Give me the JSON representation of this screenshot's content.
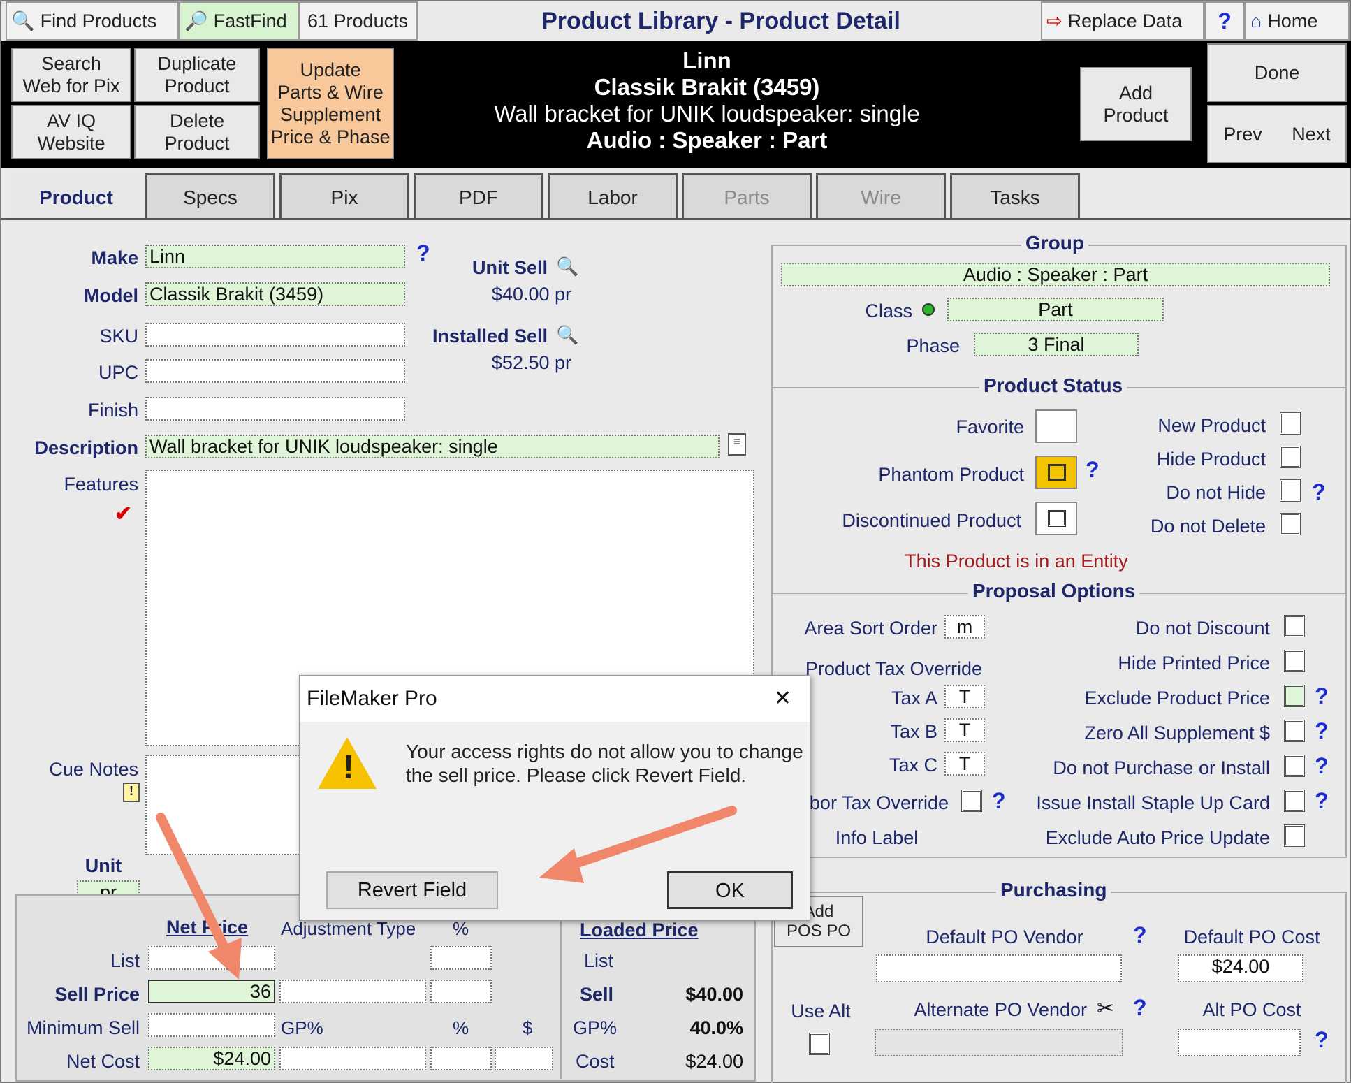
{
  "toolbar": {
    "find": "Find Products",
    "fastfind": "FastFind",
    "count": "61 Products",
    "title": "Product Library - Product Detail",
    "replace": "Replace Data",
    "help": "?",
    "home": "Home"
  },
  "nav": {
    "search1": "Search",
    "search2": "Web for Pix",
    "dup1": "Duplicate",
    "dup2": "Product",
    "av1": "AV IQ",
    "av2": "Website",
    "del1": "Delete",
    "del2": "Product",
    "upd1": "Update",
    "upd2": "Parts & Wire",
    "upd3": "Supplement",
    "upd4": "Price & Phase",
    "add1": "Add",
    "add2": "Product",
    "done": "Done",
    "prev": "Prev",
    "next": "Next"
  },
  "header": {
    "make": "Linn",
    "model": "Classik Brakit (3459)",
    "desc": "Wall bracket for UNIK loudspeaker: single",
    "group": "Audio : Speaker : Part"
  },
  "tabs": [
    "Product",
    "Specs",
    "Pix",
    "PDF",
    "Labor",
    "Parts",
    "Wire",
    "Tasks"
  ],
  "product": {
    "make_label": "Make",
    "make": "Linn",
    "model_label": "Model",
    "model": "Classik Brakit (3459)",
    "sku_label": "SKU",
    "upc_label": "UPC",
    "finish_label": "Finish",
    "desc_label": "Description",
    "desc": "Wall bracket for UNIK loudspeaker: single",
    "features_label": "Features",
    "cue_label": "Cue Notes",
    "unit_label": "Unit",
    "unit": "pr",
    "unit_sell_label": "Unit Sell",
    "unit_sell": "$40.00 pr",
    "inst_sell_label": "Installed Sell",
    "inst_sell": "$52.50 pr",
    "q": "?"
  },
  "group": {
    "title": "Group",
    "value": "Audio : Speaker : Part",
    "class_label": "Class",
    "class": "Part",
    "phase_label": "Phase",
    "phase": "3 Final"
  },
  "status": {
    "title": "Product Status",
    "favorite": "Favorite",
    "phantom": "Phantom Product",
    "discontinued": "Discontinued Product",
    "new": "New Product",
    "hide": "Hide Product",
    "nothide": "Do not Hide",
    "notdelete": "Do not Delete",
    "entity": "This Product is in an Entity"
  },
  "proposal": {
    "title": "Proposal Options",
    "area": "Area Sort Order",
    "area_val": "m",
    "taxover": "Product Tax Override",
    "taxa": "Tax A",
    "taxb": "Tax B",
    "taxc": "Tax C",
    "tval": "T",
    "labor": "bor Tax Override",
    "info": "Info Label",
    "nodisc": "Do not Discount",
    "hideprice": "Hide Printed Price",
    "excl": "Exclude Product Price",
    "zero": "Zero All Supplement $",
    "nopurch": "Do not Purchase or Install",
    "staple": "Issue Install Staple Up Card",
    "auto": "Exclude Auto Price Update"
  },
  "pricing": {
    "net": "Net Price",
    "adj": "Adjustment Type",
    "pct": "%",
    "list": "List",
    "sell": "Sell Price",
    "sell_val": "36",
    "min": "Minimum Sell",
    "gp": "GP%",
    "pct2": "%",
    "dol": "$",
    "cost": "Net Cost",
    "cost_val": "$24.00",
    "loaded": "Loaded Price",
    "l_list": "List",
    "l_sell": "Sell",
    "l_sell_val": "$40.00",
    "l_gp": "GP%",
    "l_gp_val": "40.0%",
    "l_cost": "Cost",
    "l_cost_val": "$24.00"
  },
  "purch": {
    "title": "Purchasing",
    "addpo1": "Add",
    "addpo2": "POS PO",
    "defv": "Default PO Vendor",
    "defc": "Default PO Cost",
    "defc_val": "$24.00",
    "usealt": "Use Alt",
    "altv": "Alternate PO Vendor",
    "altc": "Alt PO Cost"
  },
  "dialog": {
    "title": "FileMaker Pro",
    "msg1": "Your access rights do not allow you to change",
    "msg2": "the sell price. Please click Revert Field.",
    "revert": "Revert Field",
    "ok": "OK",
    "close": "✕"
  },
  "colors": {
    "arrow": "#f0866a",
    "green_field": "#dff5d8",
    "orange_button": "#f9c89a"
  }
}
